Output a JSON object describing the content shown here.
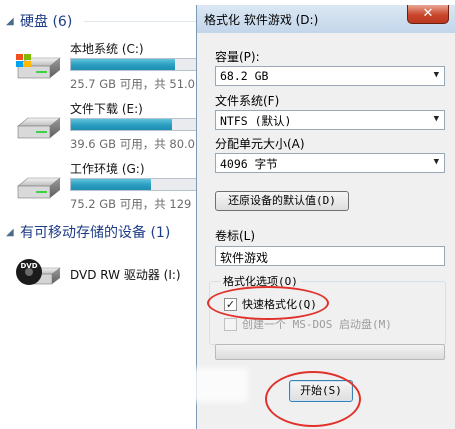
{
  "explorer": {
    "hard_disks": {
      "title": "硬盘 (6)",
      "drives": [
        {
          "name": "本地系统 (C:)",
          "free_text": "25.7 GB 可用，共 51.0",
          "used_fraction": 0.75,
          "icon": "windows-drive-icon"
        },
        {
          "name": "文件下载 (E:)",
          "free_text": "39.6 GB 可用，共 80.0",
          "used_fraction": 0.73,
          "icon": "hard-drive-icon"
        },
        {
          "name": "工作环境 (G:)",
          "free_text": "75.2 GB 可用，共 129",
          "used_fraction": 0.58,
          "icon": "hard-drive-icon"
        }
      ]
    },
    "removable": {
      "title": "有可移动存储的设备 (1)",
      "devices": [
        {
          "name": "DVD RW 驱动器 (I:)",
          "icon": "dvd-drive-icon",
          "badge": "DVD"
        }
      ]
    }
  },
  "dialog": {
    "title": "格式化 软件游戏 (D:)",
    "close_symbol": "✕",
    "capacity": {
      "label": "容量(P):",
      "value": "68.2 GB"
    },
    "filesystem": {
      "label": "文件系统(F)",
      "value": "NTFS (默认)"
    },
    "allocation": {
      "label": "分配单元大小(A)",
      "value": "4096 字节"
    },
    "restore_button": "还原设备的默认值(D)",
    "volume": {
      "label": "卷标(L)",
      "value": "软件游戏"
    },
    "options": {
      "legend": "格式化选项(O)",
      "quick_format": {
        "label": "快速格式化(Q)",
        "checked": true
      },
      "msdos": {
        "label": "创建一个 MS-DOS 启动盘(M)",
        "checked": false,
        "enabled": false
      }
    },
    "progress_fraction": 0,
    "start_button": "开始(S)"
  },
  "colors": {
    "annotation_red": "#e0322b",
    "drive_bar": "#2a9dc0",
    "section_title": "#1e3d86"
  }
}
